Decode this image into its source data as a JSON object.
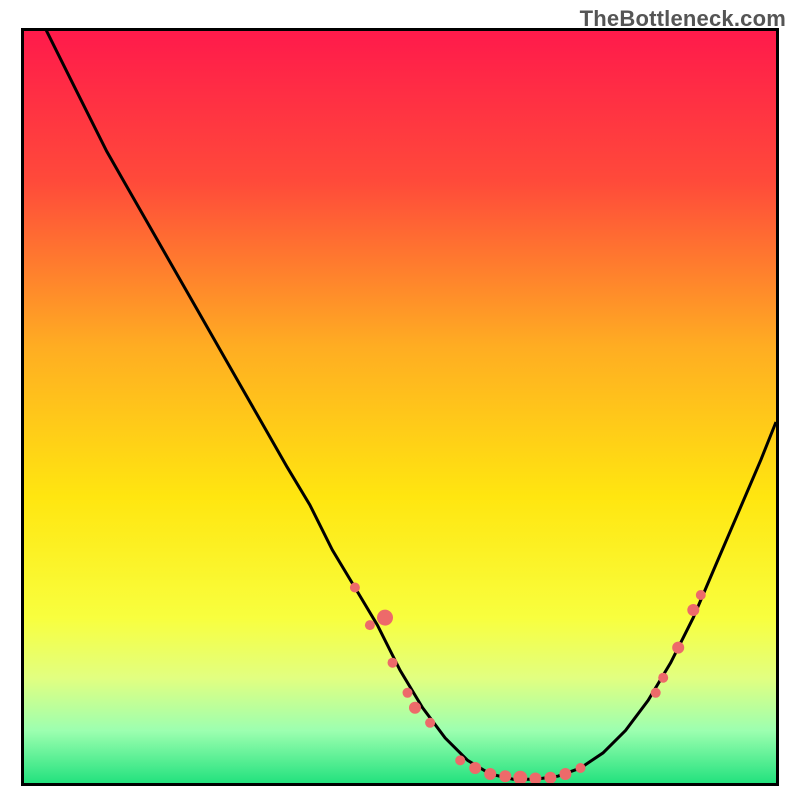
{
  "watermark": "TheBottleneck.com",
  "chart_data": {
    "type": "line",
    "title": "",
    "xlabel": "",
    "ylabel": "",
    "xlim": [
      0,
      100
    ],
    "ylim": [
      0,
      100
    ],
    "grid": false,
    "legend": false,
    "background_gradient_stops": [
      {
        "offset": 0,
        "color": "#ff1a4b"
      },
      {
        "offset": 20,
        "color": "#ff4a3a"
      },
      {
        "offset": 42,
        "color": "#ffad22"
      },
      {
        "offset": 62,
        "color": "#ffe610"
      },
      {
        "offset": 78,
        "color": "#f8ff3e"
      },
      {
        "offset": 86,
        "color": "#e2ff80"
      },
      {
        "offset": 93,
        "color": "#9dffb0"
      },
      {
        "offset": 100,
        "color": "#23e27e"
      }
    ],
    "series": [
      {
        "name": "bottleneck-curve",
        "stroke": "#000000",
        "x": [
          0,
          3,
          7,
          11,
          15,
          19,
          23,
          27,
          31,
          35,
          38,
          41,
          44,
          47,
          50,
          53,
          56,
          59,
          62,
          65,
          68,
          71,
          74,
          77,
          80,
          83,
          86,
          89,
          92,
          95,
          98,
          100
        ],
        "y": [
          107,
          100,
          92,
          84,
          77,
          70,
          63,
          56,
          49,
          42,
          37,
          31,
          26,
          21,
          15,
          10,
          6,
          3,
          1.2,
          0.5,
          0.5,
          0.9,
          2,
          4,
          7,
          11,
          16,
          22,
          29,
          36,
          43,
          48
        ]
      }
    ],
    "points": {
      "name": "marker-dots",
      "color": "#ed6a6a",
      "radius_range": [
        4,
        8
      ],
      "items": [
        {
          "x": 44,
          "y": 26,
          "r": 5
        },
        {
          "x": 46,
          "y": 21,
          "r": 5
        },
        {
          "x": 48,
          "y": 22,
          "r": 8
        },
        {
          "x": 49,
          "y": 16,
          "r": 5
        },
        {
          "x": 51,
          "y": 12,
          "r": 5
        },
        {
          "x": 52,
          "y": 10,
          "r": 6
        },
        {
          "x": 54,
          "y": 8,
          "r": 5
        },
        {
          "x": 58,
          "y": 3,
          "r": 5
        },
        {
          "x": 60,
          "y": 2,
          "r": 6
        },
        {
          "x": 62,
          "y": 1.2,
          "r": 6
        },
        {
          "x": 64,
          "y": 0.9,
          "r": 6
        },
        {
          "x": 66,
          "y": 0.7,
          "r": 7
        },
        {
          "x": 68,
          "y": 0.6,
          "r": 6
        },
        {
          "x": 70,
          "y": 0.7,
          "r": 6
        },
        {
          "x": 72,
          "y": 1.2,
          "r": 6
        },
        {
          "x": 74,
          "y": 2,
          "r": 5
        },
        {
          "x": 84,
          "y": 12,
          "r": 5
        },
        {
          "x": 85,
          "y": 14,
          "r": 5
        },
        {
          "x": 87,
          "y": 18,
          "r": 6
        },
        {
          "x": 89,
          "y": 23,
          "r": 6
        },
        {
          "x": 90,
          "y": 25,
          "r": 5
        }
      ]
    }
  }
}
